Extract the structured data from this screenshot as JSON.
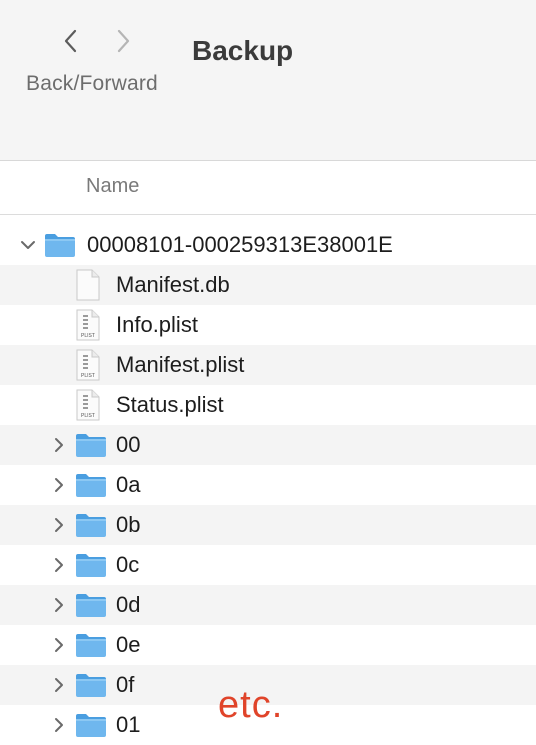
{
  "toolbar": {
    "nav_label": "Back/Forward",
    "title": "Backup"
  },
  "columns": {
    "name": "Name"
  },
  "rows": [
    {
      "label": "00008101-000259313E38001E",
      "kind": "folder",
      "level": 0,
      "expanded": true
    },
    {
      "label": "Manifest.db",
      "kind": "doc",
      "level": 1
    },
    {
      "label": "Info.plist",
      "kind": "plist",
      "level": 1
    },
    {
      "label": "Manifest.plist",
      "kind": "plist",
      "level": 1
    },
    {
      "label": "Status.plist",
      "kind": "plist",
      "level": 1
    },
    {
      "label": "00",
      "kind": "folder",
      "level": 1,
      "expanded": false
    },
    {
      "label": "0a",
      "kind": "folder",
      "level": 1,
      "expanded": false
    },
    {
      "label": "0b",
      "kind": "folder",
      "level": 1,
      "expanded": false
    },
    {
      "label": "0c",
      "kind": "folder",
      "level": 1,
      "expanded": false
    },
    {
      "label": "0d",
      "kind": "folder",
      "level": 1,
      "expanded": false
    },
    {
      "label": "0e",
      "kind": "folder",
      "level": 1,
      "expanded": false
    },
    {
      "label": "0f",
      "kind": "folder",
      "level": 1,
      "expanded": false
    },
    {
      "label": "01",
      "kind": "folder",
      "level": 1,
      "expanded": false
    }
  ],
  "annotation": "etc.",
  "colors": {
    "folder_fill": "#6fb7ee",
    "folder_tab": "#4a9ee0",
    "annotation": "#e0442a",
    "row_alt": "#f4f4f4"
  }
}
